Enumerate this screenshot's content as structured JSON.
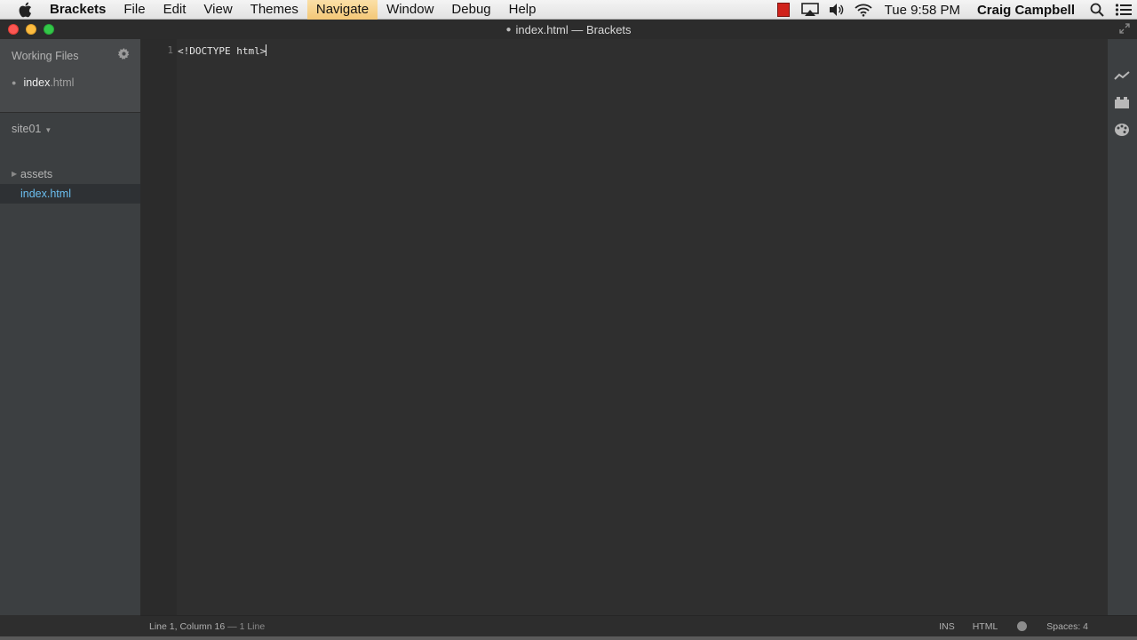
{
  "menubar": {
    "app_name": "Brackets",
    "items": [
      "File",
      "Edit",
      "View",
      "Themes",
      "Navigate",
      "Window",
      "Debug",
      "Help"
    ],
    "highlighted_item": "Navigate",
    "clock": "Tue 9:58 PM",
    "user": "Craig Campbell"
  },
  "window": {
    "title": "index.html — Brackets",
    "title_dirty_marker": "●"
  },
  "sidebar": {
    "working_files_label": "Working Files",
    "working_file": {
      "name": "index",
      "ext": ".html"
    },
    "project_name": "site01",
    "tree": [
      {
        "label": "assets",
        "type": "folder"
      },
      {
        "label": "index.html",
        "type": "file",
        "selected": true
      }
    ]
  },
  "editor": {
    "line_number": "1",
    "code": "<!DOCTYPE html>"
  },
  "statusbar": {
    "position": "Line 1, Column 16",
    "line_count": " — 1 Line",
    "mode": "INS",
    "language": "HTML",
    "indent": "Spaces: 4"
  },
  "colors": {
    "selected_file": "#6bbeef",
    "menu_highlight": "#f3c776"
  }
}
